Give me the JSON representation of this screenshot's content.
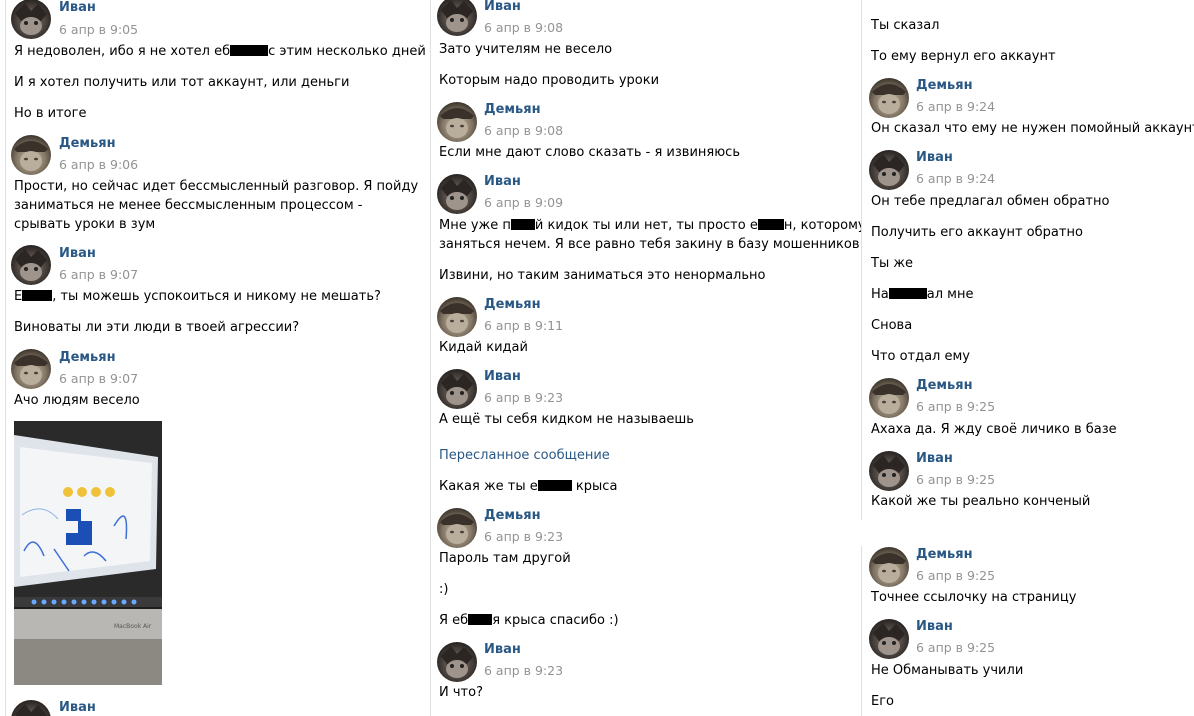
{
  "senders": {
    "ivan": "Иван",
    "demyan": "Демьян"
  },
  "col1": {
    "m1": {
      "time": "6 апр в 9:05",
      "lines": {
        "a1": "Я недоволен, ибо я не хотел еб",
        "a2": "с этим несколько дней",
        "b": "И я хотел получить или тот аккаунт, или деньги",
        "c": "Но в итоге"
      }
    },
    "m2": {
      "time": "6 апр в 9:06",
      "text": "Прости, но сейчас идет бессмысленный разговор. Я пойду заниматься не менее бессмысленным процессом - срывать уроки в зум"
    },
    "m3": {
      "time": "6 апр в 9:07",
      "lines": {
        "a1": "Е",
        "a2": ", ты можешь успокоиться и никому не мешать?",
        "b": "Виноваты ли эти люди в твоей агрессии?"
      }
    },
    "m4": {
      "time": "6 апр в 9:07",
      "text": "Ачо людям весело",
      "photo_caption": "MacBook Air"
    }
  },
  "col2": {
    "m1": {
      "time": "6 апр в 9:08",
      "lines": {
        "a": "Зато учителям не весело",
        "b": "Которым надо проводить уроки"
      }
    },
    "m2": {
      "time": "6 апр в 9:08",
      "text": "Если мне дают слово сказать - я извиняюсь"
    },
    "m3": {
      "time": "6 апр в 9:09",
      "lines": {
        "a1": "Мне уже п",
        "a2": "й кидок ты или нет, ты просто е",
        "a3": "н, которому",
        "a4": "заняться нечем. Я все равно тебя закину в базу мошенников",
        "b": "Извини, но таким заниматься это ненормально"
      }
    },
    "m4": {
      "time": "6 апр в 9:11",
      "text": "Кидай кидай"
    },
    "m5": {
      "time": "6 апр в 9:23",
      "lines": {
        "a": "А ещё ты себя кидком не называешь",
        "fwd": "Пересланное сообщение",
        "b1": "Какая же ты е",
        "b2": "крыса"
      }
    },
    "m6": {
      "time": "6 апр в 9:23",
      "lines": {
        "a": "Пароль там другой",
        "b": ":)",
        "c1": "Я еб",
        "c2": "я крыса спасибо :)"
      }
    },
    "m7": {
      "time": "6 апр в 9:23",
      "text": "И что?"
    }
  },
  "col3": {
    "top": {
      "a": "Ты сказал",
      "b": "То ему вернул его аккаунт"
    },
    "m1": {
      "time": "6 апр в 9:24",
      "text": "Он сказал что ему не нужен помойный аккаунт"
    },
    "m2": {
      "time": "6 апр в 9:24",
      "lines": {
        "a": "Он тебе предлагал обмен обратно",
        "b": "Получить его аккаунт обратно",
        "c": "Ты же",
        "d1": "На",
        "d2": "ал мне",
        "e": "Снова",
        "f": "Что отдал ему"
      }
    },
    "m3": {
      "time": "6 апр в 9:25",
      "text": "Ахаха да. Я жду своё личико в базе"
    },
    "m4": {
      "time": "6 апр в 9:25",
      "text": "Какой же ты реально конченый"
    },
    "m5": {
      "time": "6 апр в 9:25",
      "text": "Точнее ссылочку на страницу"
    },
    "m6": {
      "time": "6 апр в 9:25",
      "lines": {
        "a": "Не Обманывать учили",
        "b": "Его"
      }
    }
  }
}
